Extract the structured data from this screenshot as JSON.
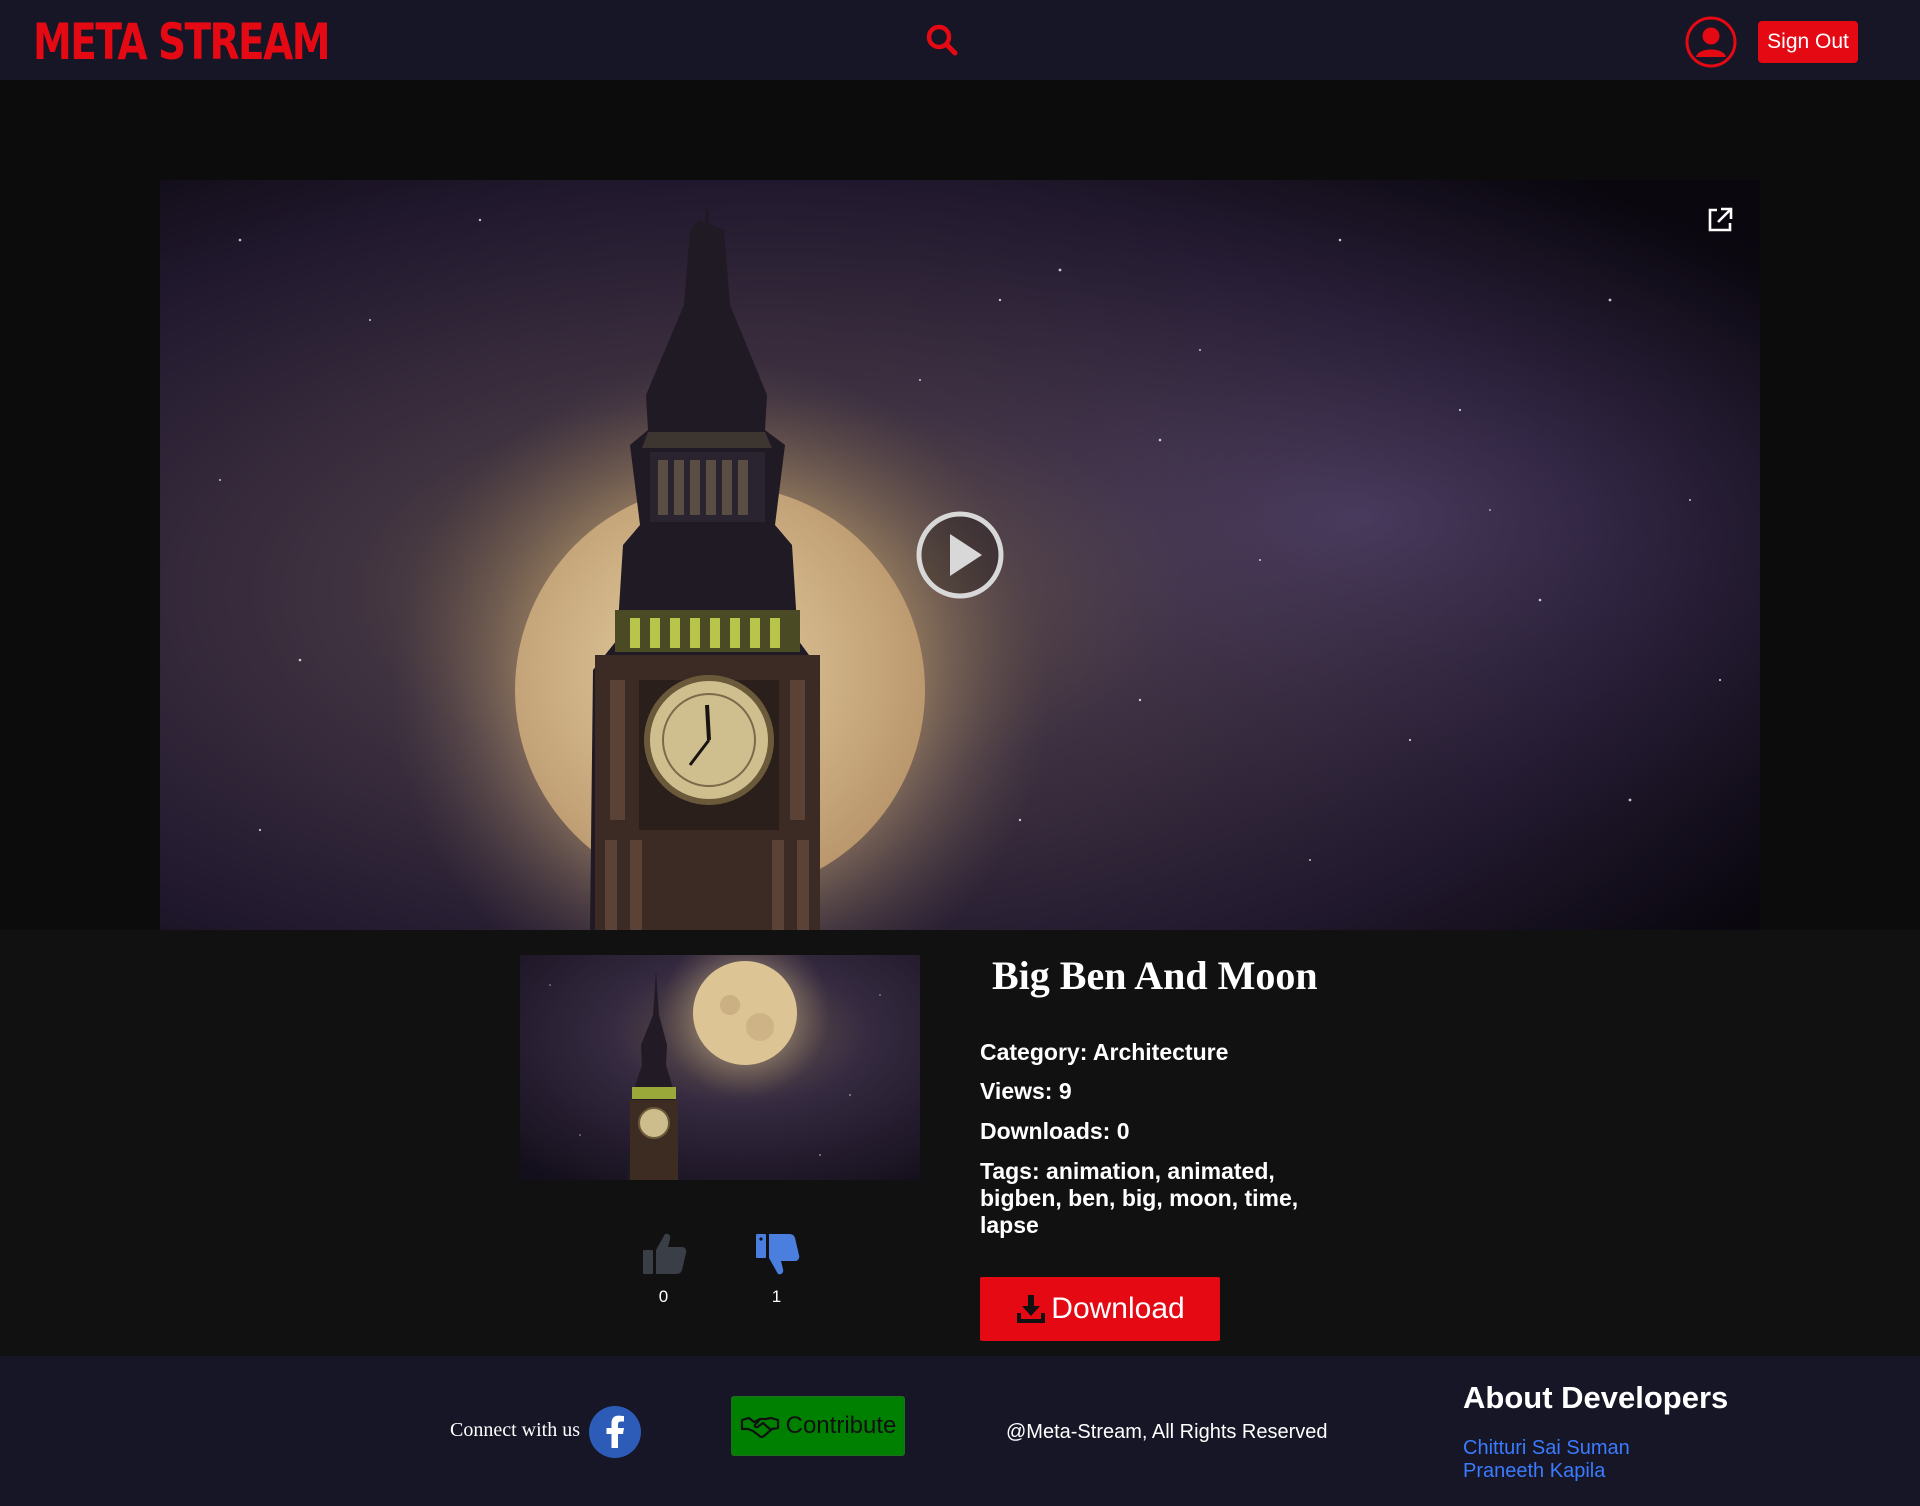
{
  "header": {
    "logo": "META STREAM",
    "sign_out": "Sign Out"
  },
  "video": {
    "title": "Big Ben And Moon"
  },
  "info": {
    "title": "Big Ben And Moon",
    "category": "Category: Architecture",
    "views": "Views: 9",
    "downloads": "Downloads: 0",
    "tags": "Tags: animation, animated, bigben, ben, big, moon, time, lapse",
    "likes": "0",
    "dislikes": "1",
    "download_label": "Download"
  },
  "footer": {
    "connect": "Connect with us",
    "contribute": "Contribute",
    "rights": "@Meta-Stream, All Rights Reserved",
    "about_title": "About Developers",
    "developers": [
      "Chitturi Sai Suman",
      "Praneeth Kapila"
    ]
  },
  "colors": {
    "accent": "#e50914",
    "header_bg": "#161626",
    "contribute_bg": "#008000",
    "link": "#3a7bff",
    "dislike_active": "#4a7fe0",
    "like_inactive": "#3a3f47"
  },
  "icons": {
    "search": "search-icon",
    "avatar": "user-circle-icon",
    "play": "play-circle-icon",
    "popout": "external-link-icon",
    "like": "thumbs-up-icon",
    "dislike": "thumbs-down-icon",
    "download": "download-icon",
    "facebook": "facebook-icon",
    "contribute": "handshake-icon"
  }
}
